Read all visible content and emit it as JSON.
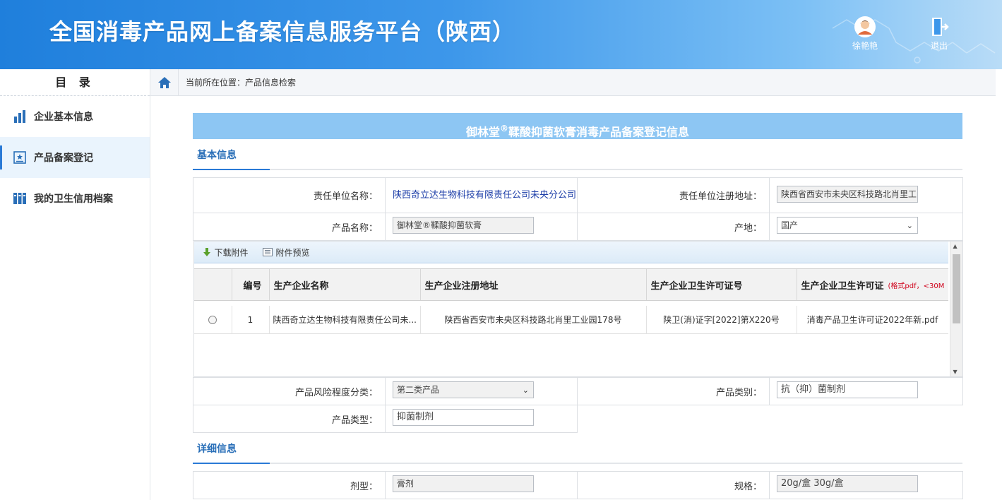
{
  "header": {
    "title": "全国消毒产品网上备案信息服务平台（陕西）",
    "user_label": "徐艳艳",
    "logout_label": "退出"
  },
  "sidebar": {
    "title": "目 录",
    "items": [
      {
        "label": "企业基本信息",
        "icon": "building-chart-icon"
      },
      {
        "label": "产品备案登记",
        "icon": "registration-doc-icon"
      },
      {
        "label": "我的卫生信用档案",
        "icon": "archive-binders-icon"
      }
    ],
    "active_index": 1
  },
  "breadcrumb": {
    "text": "当前所在位置：产品信息检索"
  },
  "form": {
    "banner_prefix": "御林堂",
    "banner_mark": "®",
    "banner_suffix": "鞣酸抑菌软膏消毒产品备案登记信息",
    "section_basic": "基本信息",
    "section_detail": "详细信息",
    "fields": {
      "resp_unit_label": "责任单位名称：",
      "resp_unit_value": "陕西奇立达生物科技有限责任公司未央分公司",
      "resp_addr_label": "责任单位注册地址：",
      "resp_addr_value": "陕西省西安市未央区科技路北肖里工",
      "product_name_label": "产品名称：",
      "product_name_value": "御林堂®鞣酸抑菌软膏",
      "origin_label": "产地：",
      "origin_value": "国产",
      "risk_label": "产品风险程度分类：",
      "risk_value": "第二类产品",
      "category_label": "产品类别：",
      "category_value": "抗（抑）菌制剂",
      "type_label": "产品类型：",
      "type_value": "抑菌制剂",
      "dosage_label": "剂型：",
      "dosage_value": "膏剂",
      "spec_label": "规格：",
      "spec_value": "20g/盒  30g/盒"
    }
  },
  "grid": {
    "toolbar": {
      "download": "下载附件",
      "preview": "附件预览"
    },
    "columns": [
      "编号",
      "生产企业名称",
      "生产企业注册地址",
      "生产企业卫生许可证号",
      "生产企业卫生许可证"
    ],
    "file_format_note": "(格式pdf，<30M",
    "rows": [
      {
        "no": "1",
        "name": "陕西奇立达生物科技有限责任公司未...",
        "address": "陕西省西安市未央区科技路北肖里工业园178号",
        "license_no": "陕卫(消)证字[2022]第X220号",
        "license_file": "消毒产品卫生许可证2022年新.pdf"
      }
    ]
  },
  "colors": {
    "header_blue": "#1f7fdc",
    "banner_blue": "#8dc6f3",
    "section_blue": "#2a6fb8",
    "link_blue": "#1d3ea8",
    "note_red": "#d0021b"
  }
}
